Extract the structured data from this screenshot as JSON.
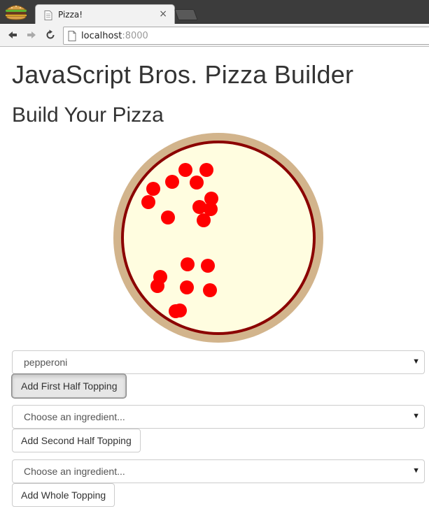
{
  "browser": {
    "tab_title": "Pizza!",
    "close_glyph": "×",
    "url_host": "localhost",
    "url_port": ":8000",
    "icons": {
      "app_logo": "burger-icon",
      "favicon": "page-icon",
      "back": "back-arrow-icon",
      "forward": "forward-arrow-icon",
      "reload": "reload-icon"
    }
  },
  "page": {
    "title": "JavaScript Bros. Pizza Builder",
    "subtitle": "Build Your Pizza"
  },
  "pizza": {
    "crust_color": "#d2b48c",
    "sauce_ring_color": "#8b0000",
    "cheese_color": "#fffde0",
    "pepperoni_color": "#ff0000",
    "pepperoni_count": 22
  },
  "controls": {
    "first_half": {
      "selected": "pepperoni",
      "button_label": "Add First Half Topping"
    },
    "second_half": {
      "selected": "Choose an ingredient...",
      "button_label": "Add Second Half Topping"
    },
    "whole": {
      "selected": "Choose an ingredient...",
      "button_label": "Add Whole Topping"
    },
    "caret_glyph": "▼"
  }
}
